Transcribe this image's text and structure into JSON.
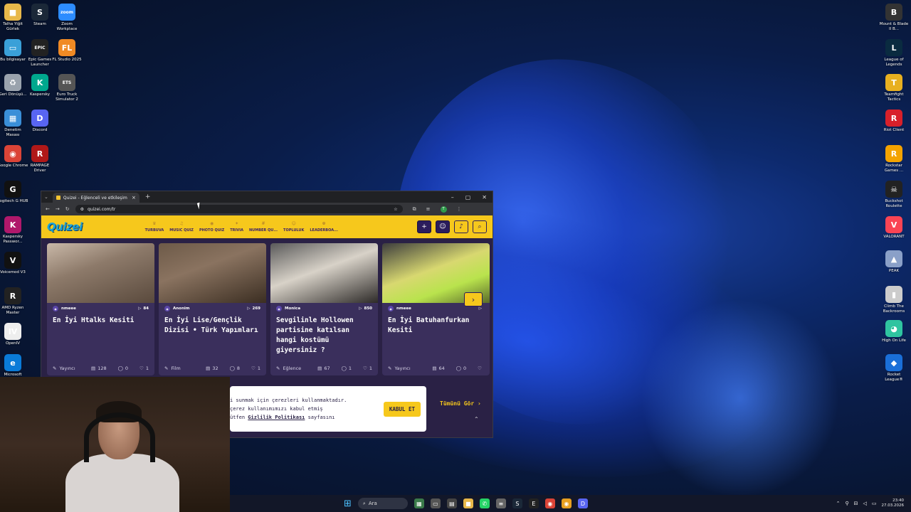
{
  "desktop": {
    "left_icons": [
      {
        "label": "Talha Yiğit Gürlek",
        "color": "#e8b84a",
        "glyph": "■",
        "icon": "folder-icon"
      },
      {
        "label": "Steam",
        "color": "#1b2838",
        "glyph": "S",
        "icon": "steam-icon"
      },
      {
        "label": "Zoom Workplace",
        "color": "#2d8cff",
        "glyph": "zoom",
        "icon": "zoom-icon"
      },
      {
        "label": "Bu bilgisayar",
        "color": "#3aa0d8",
        "glyph": "▭",
        "icon": "computer-icon"
      },
      {
        "label": "Epic Games Launcher",
        "color": "#222",
        "glyph": "EPIC",
        "icon": "epic-games-icon"
      },
      {
        "label": "FL Studio 2025",
        "color": "#f08a24",
        "glyph": "FL",
        "icon": "fl-studio-icon"
      },
      {
        "label": "Geri Dönüşü...",
        "color": "#9aa3ad",
        "glyph": "♻",
        "icon": "recycle-bin-icon"
      },
      {
        "label": "Kaspersky",
        "color": "#00a88e",
        "glyph": "K",
        "icon": "kaspersky-icon"
      },
      {
        "label": "Euro Truck Simulator 2",
        "color": "#555",
        "glyph": "ETS",
        "icon": "euro-truck-icon"
      },
      {
        "label": "Denetim Masası",
        "color": "#3a8fd8",
        "glyph": "▦",
        "icon": "control-panel-icon"
      },
      {
        "label": "Discord",
        "color": "#5865f2",
        "glyph": "D",
        "icon": "discord-icon"
      },
      {
        "label": "Google Chrome",
        "color": "#db4437",
        "glyph": "◉",
        "icon": "chrome-icon"
      },
      {
        "label": "RAMPAGE Driver",
        "color": "#b01818",
        "glyph": "R",
        "icon": "rampage-icon"
      },
      {
        "label": "Logitech G HUB",
        "color": "#111",
        "glyph": "G",
        "icon": "logitech-icon"
      },
      {
        "label": "Kaspersky Passwor...",
        "color": "#b0186b",
        "glyph": "K",
        "icon": "kaspersky-password-icon"
      },
      {
        "label": "Voicemod V3",
        "color": "#111",
        "glyph": "V",
        "icon": "voicemod-icon"
      },
      {
        "label": "AMD Ryzen Master",
        "color": "#222",
        "glyph": "R",
        "icon": "ryzen-master-icon"
      },
      {
        "label": "OpenIV",
        "color": "#eee",
        "glyph": "IV",
        "icon": "openiv-icon"
      },
      {
        "label": "Microsoft",
        "color": "#0a7bd8",
        "glyph": "e",
        "icon": "edge-icon"
      }
    ],
    "right_icons": [
      {
        "label": "Mount & Blade II B...",
        "color": "#333",
        "glyph": "B",
        "icon": "bannerlord-icon"
      },
      {
        "label": "League of Legends",
        "color": "#0a2b40",
        "glyph": "L",
        "icon": "league-icon"
      },
      {
        "label": "Teamfight Tactics",
        "color": "#e8b020",
        "glyph": "T",
        "icon": "tft-icon"
      },
      {
        "label": "Riot Client",
        "color": "#d8202a",
        "glyph": "R",
        "icon": "riot-icon"
      },
      {
        "label": "Rockstar Games ...",
        "color": "#f4a300",
        "glyph": "R",
        "icon": "rockstar-icon"
      },
      {
        "label": "Buckshot Roulette",
        "color": "#222",
        "glyph": "☠",
        "icon": "buckshot-icon"
      },
      {
        "label": "VALORANT",
        "color": "#fa4454",
        "glyph": "V",
        "icon": "valorant-icon"
      },
      {
        "label": "PEAK",
        "color": "#8aa0c8",
        "glyph": "▲",
        "icon": "peak-icon"
      },
      {
        "label": "Climb The Backrooms",
        "color": "#ccc",
        "glyph": "▮",
        "icon": "climb-backrooms-icon"
      },
      {
        "label": "High On Life",
        "color": "#2fc4a0",
        "glyph": "◕",
        "icon": "high-on-life-icon"
      },
      {
        "label": "Rocket League®",
        "color": "#1a6fd8",
        "glyph": "◆",
        "icon": "rocket-league-icon"
      }
    ]
  },
  "browser": {
    "tab_title": "Quizei - Eğlenceli ve etkileşimli",
    "url": "quizei.com/tr",
    "profile_initial": "T"
  },
  "site": {
    "logo": "Quizei",
    "nav": [
      {
        "label": "TURBUVA",
        "icon": "trophy-icon",
        "glyph": "♛"
      },
      {
        "label": "MUSIC QUIZ",
        "icon": "music-icon",
        "glyph": "♫"
      },
      {
        "label": "PHOTO QUIZ",
        "icon": "photo-icon",
        "glyph": "◉"
      },
      {
        "label": "TRIVIA",
        "icon": "trivia-icon",
        "glyph": "✦"
      },
      {
        "label": "NUMBER QU...",
        "icon": "number-icon",
        "glyph": "#"
      },
      {
        "label": "TOPLULUK",
        "icon": "community-icon",
        "glyph": "☺"
      },
      {
        "label": "LEADERBOA...",
        "icon": "leaderboard-icon",
        "glyph": "♚"
      }
    ],
    "cards": [
      {
        "author": "nmeee",
        "plays": "84",
        "title": "En İyi Htalks Kesiti",
        "category": "Yayıncı",
        "questions": "128",
        "comments": "0",
        "likes": "1"
      },
      {
        "author": "Anonim",
        "plays": "269",
        "title": "En İyi Lise/Gençlik Dizisi • Türk Yapımları",
        "category": "Film",
        "questions": "32",
        "comments": "8",
        "likes": "1"
      },
      {
        "author": "Monica",
        "plays": "850",
        "title": "Sevgilinle Hollowen partisine katılsan hangi kostümü giyersiniz ?",
        "category": "Eğlence",
        "questions": "67",
        "comments": "1",
        "likes": "1"
      },
      {
        "author": "nmeee",
        "plays": "",
        "title": "En İyi Batuhanfurkan Kesiti",
        "category": "Yayıncı",
        "questions": "64",
        "comments": "0",
        "likes": ""
      }
    ],
    "see_all": "Tümünü Gör",
    "cookie": {
      "line1": "i sunmak için çerezleri kullanmaktadır.",
      "line2": "çerez kullanımımızı kabul etmiş",
      "line3_pre": "ütfen ",
      "link": "Gizlilik Politikası",
      "line3_post": " sayfasını",
      "button": "KABUL ET"
    }
  },
  "taskbar": {
    "search_placeholder": "Ara",
    "time": "23:40",
    "date": "27.03.2026"
  }
}
